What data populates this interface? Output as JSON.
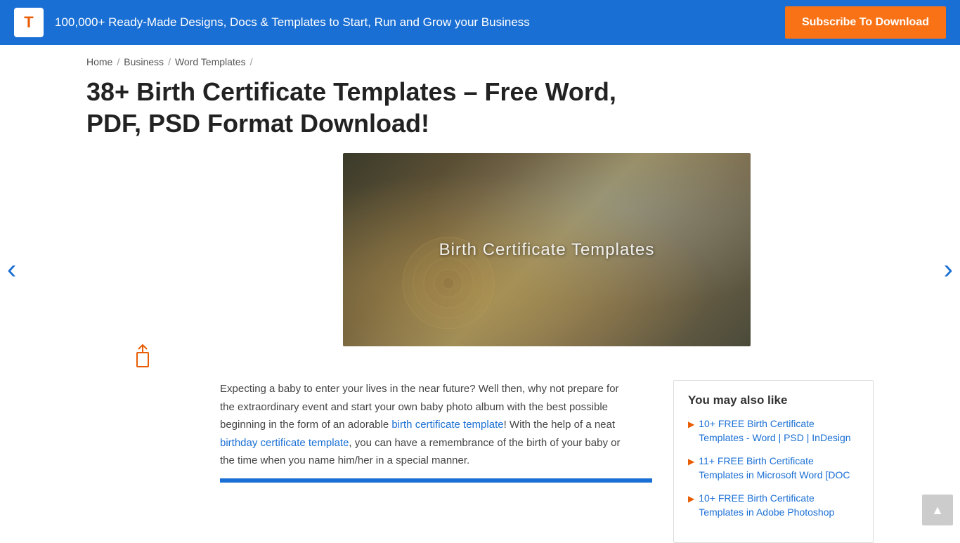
{
  "banner": {
    "logo": "T",
    "text": "100,000+ Ready-Made Designs, Docs & Templates to Start, Run and Grow your Business",
    "subscribe_label": "Subscribe To Download"
  },
  "breadcrumb": {
    "items": [
      "Home",
      "Business",
      "Word Templates"
    ],
    "separator": "/"
  },
  "page": {
    "title": "38+ Birth Certificate Templates – Free Word, PDF, PSD Format Download!",
    "hero_image_text": "Birth Certificate Templates",
    "body_text_1": "Expecting a baby to enter your lives in the near future? Well then, why not prepare for the extraordinary event and start your own baby photo album with the best possible beginning in the form of an adorable ",
    "link1_text": "birth certificate template",
    "link1_href": "#",
    "body_text_2": "! With the help of a neat ",
    "link2_text": "birthday certificate template",
    "link2_href": "#",
    "body_text_3": ", you can have a remembrance of the birth of your baby or the time when you name him/her in a special manner."
  },
  "sidebar": {
    "title": "You may also like",
    "links": [
      {
        "text": "10+ FREE Birth Certificate Templates - Word | PSD | InDesign",
        "href": "#"
      },
      {
        "text": "11+ FREE Birth Certificate Templates in Microsoft Word [DOC",
        "href": "#"
      },
      {
        "text": "10+ FREE Birth Certificate Templates in Adobe Photoshop",
        "href": "#"
      }
    ]
  },
  "arrows": {
    "left": "‹",
    "right": "›"
  },
  "scroll_top": "▲"
}
